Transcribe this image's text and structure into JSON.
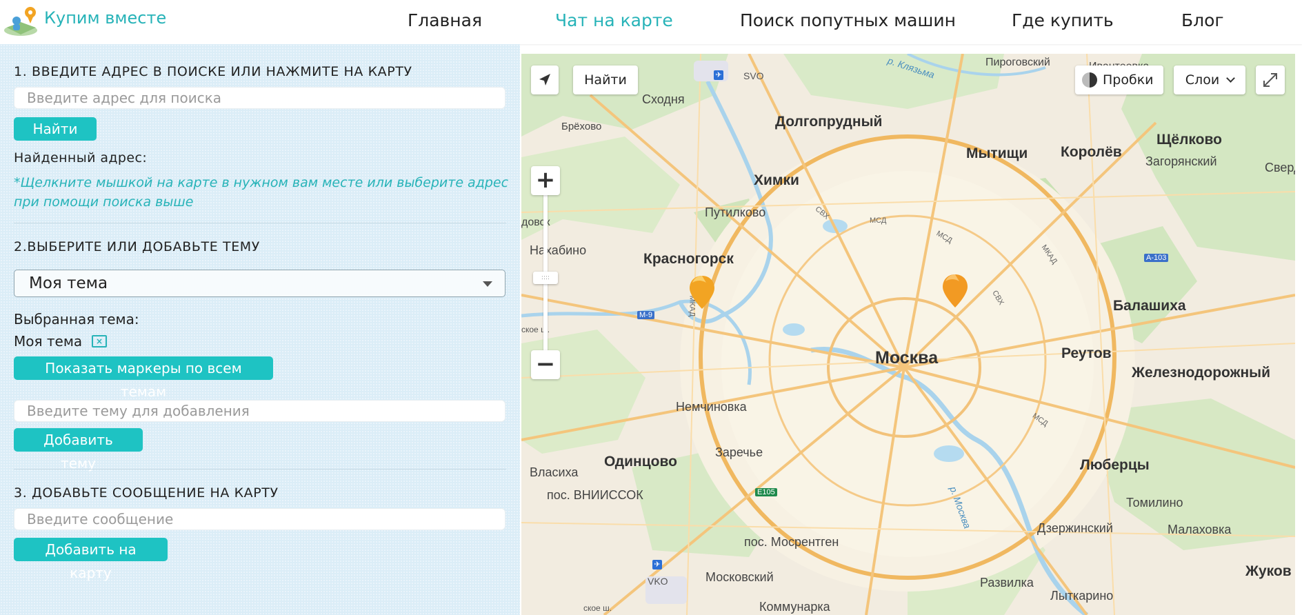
{
  "header": {
    "brand": "Купим вместе",
    "nav": [
      {
        "label": "Главная"
      },
      {
        "label": "Чат на карте"
      },
      {
        "label": "Поиск попутных машин"
      },
      {
        "label": "Где купить"
      },
      {
        "label": "Блог"
      }
    ]
  },
  "step1": {
    "title": "1. ВВЕДИТЕ АДРЕС В ПОИСКЕ ИЛИ НАЖМИТЕ НА КАРТУ",
    "search_placeholder": "Введите адрес для поиска",
    "find_button": "Найти",
    "found_label": "Найденный адрес:",
    "hint": "*Щелкните мышкой на карте в нужном вам месте или выберите адрес при помощи поиска выше"
  },
  "step2": {
    "title": "2.ВЫБЕРИТЕ ИЛИ ДОБАВЬТЕ ТЕМУ",
    "selected_option": "Моя тема",
    "selected_label": "Выбранная тема:",
    "selected_value": "Моя тема",
    "show_all_button": "Показать маркеры по всем темам",
    "topic_placeholder": "Введите тему для добавления",
    "add_topic_button": "Добавить тему"
  },
  "step3": {
    "title": "3. ДОБАВЬТЕ СООБЩЕНИЕ НА КАРТУ",
    "message_placeholder": "Введите сообщение",
    "add_button": "Добавить на карту"
  },
  "map": {
    "controls": {
      "search_button": "Найти",
      "traffic_button": "Пробки",
      "layers_button": "Слои"
    },
    "labels": {
      "moscow": "Москва",
      "dolgoprudny": "Долгопрудный",
      "mytishchi": "Мытищи",
      "korolev": "Королёв",
      "shchelkovo": "Щёлково",
      "zagoryansky": "Загорянский",
      "sverd": "Сверд",
      "khimki": "Химки",
      "skhodnya": "Сходня",
      "brekhovo": "Брёхово",
      "putilkovo": "Путилково",
      "dovsk": "довск",
      "nakhabino": "Нахабино",
      "krasnogorsk": "Красногорск",
      "balashikha": "Балашиха",
      "reutov": "Реутов",
      "zheleznodorozhny": "Железнодорожный",
      "nemchinovka": "Немчиновка",
      "odintsovo": "Одинцово",
      "zarechye": "Заречье",
      "vlasikha": "Власиха",
      "vniissok": "пос. ВНИИССОК",
      "lyubertsy": "Люберцы",
      "tomilino": "Томилино",
      "dzerzhinsky": "Дзержинский",
      "malakhovka": "Малаховка",
      "mosrentgen": "пос. Мосрентген",
      "moskovsky": "Московский",
      "razvilka": "Развилка",
      "lytkarino": "Лыткарино",
      "zhukov": "Жуков",
      "kommunarka": "Коммунарка",
      "pirogovsky": "Пироговский",
      "ivanteevka": "Ивантеевка",
      "klyazma": "р. Клязьма",
      "moskva_river": "р. Москва",
      "svo": "SVO",
      "vko": "VKO",
      "mkad1": "МКАД",
      "mkad2": "МКАД",
      "mkad3": "МКАД",
      "msd1": "МСД",
      "msd2": "МСД",
      "msd3": "МСД",
      "svkh1": "СВХ",
      "svkh2": "СВХ",
      "m9": "М-9",
      "a103": "А-103",
      "e105": "E105",
      "ske": "ское ш.",
      "svo_road": "ское ш."
    }
  },
  "colors": {
    "accent": "#27b3b8",
    "button": "#1ec3c3",
    "panel": "#dbedf7",
    "marker": "#f2a423"
  }
}
